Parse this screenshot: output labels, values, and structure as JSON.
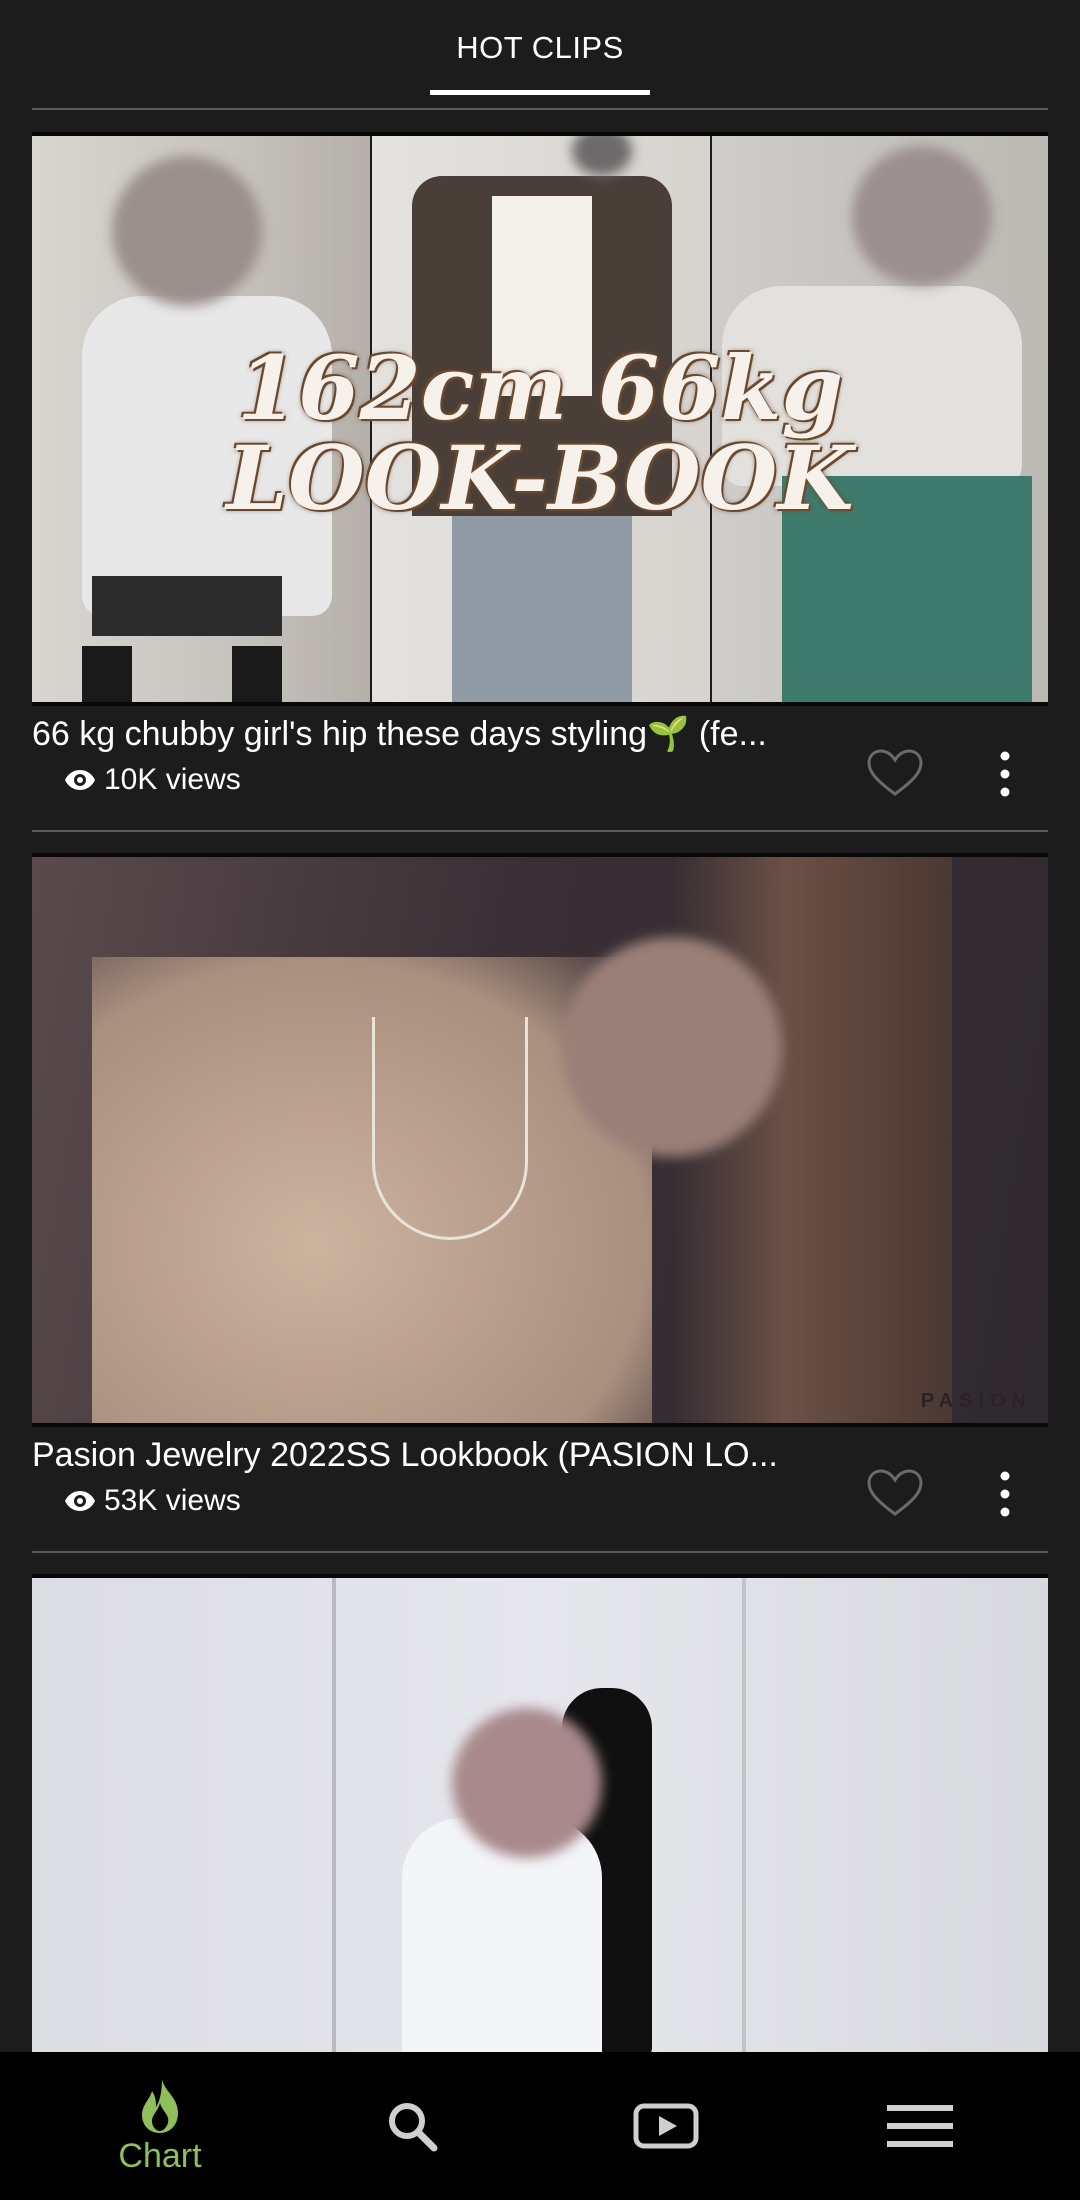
{
  "header": {
    "tab_label": "HOT CLIPS"
  },
  "clips": [
    {
      "title": "66 kg chubby girl's hip these days styling🌱 (fe...",
      "views": "10K views",
      "thumbnail_text_line1": "162cm 66kg",
      "thumbnail_text_line2": "LOOK-BOOK"
    },
    {
      "title": "Pasion Jewelry 2022SS Lookbook (PASION LO...",
      "views": "53K views",
      "thumbnail_watermark": "PASION"
    },
    {
      "title": "",
      "views": ""
    }
  ],
  "bottom_nav": {
    "items": [
      {
        "label": "Chart",
        "icon": "flame-icon",
        "active": true
      },
      {
        "label": "",
        "icon": "search-icon"
      },
      {
        "label": "",
        "icon": "video-play-icon"
      },
      {
        "label": "",
        "icon": "menu-icon"
      }
    ]
  },
  "colors": {
    "background": "#1c1c1c",
    "accent": "#8fbf5a",
    "nav_background": "#000000"
  }
}
